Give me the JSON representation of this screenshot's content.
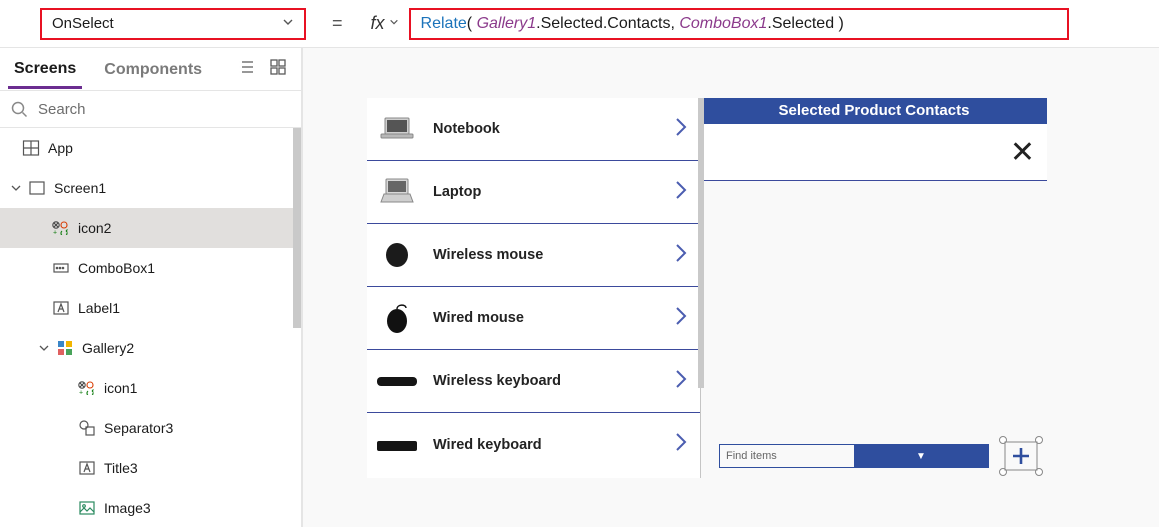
{
  "formula_bar": {
    "property": "OnSelect",
    "equals": "=",
    "fx_label": "fx",
    "formula_tokens": {
      "func": "Relate",
      "open": "( ",
      "id1": "Gallery1",
      "dot1": ".Selected.Contacts, ",
      "id2": "ComboBox1",
      "dot2": ".Selected )"
    }
  },
  "left_panel": {
    "tabs": {
      "screens": "Screens",
      "components": "Components"
    },
    "search_placeholder": "Search",
    "nodes": {
      "app": "App",
      "screen1": "Screen1",
      "icon2": "icon2",
      "combobox1": "ComboBox1",
      "label1": "Label1",
      "gallery2": "Gallery2",
      "icon1": "icon1",
      "separator3": "Separator3",
      "title3": "Title3",
      "image3": "Image3"
    }
  },
  "canvas": {
    "gallery_items": {
      "0": "Notebook",
      "1": "Laptop",
      "2": "Wireless mouse",
      "3": "Wired mouse",
      "4": "Wireless keyboard",
      "5": "Wired keyboard"
    },
    "contacts_header": "Selected Product Contacts",
    "close_glyph": "✕",
    "combo_placeholder": "Find items"
  }
}
